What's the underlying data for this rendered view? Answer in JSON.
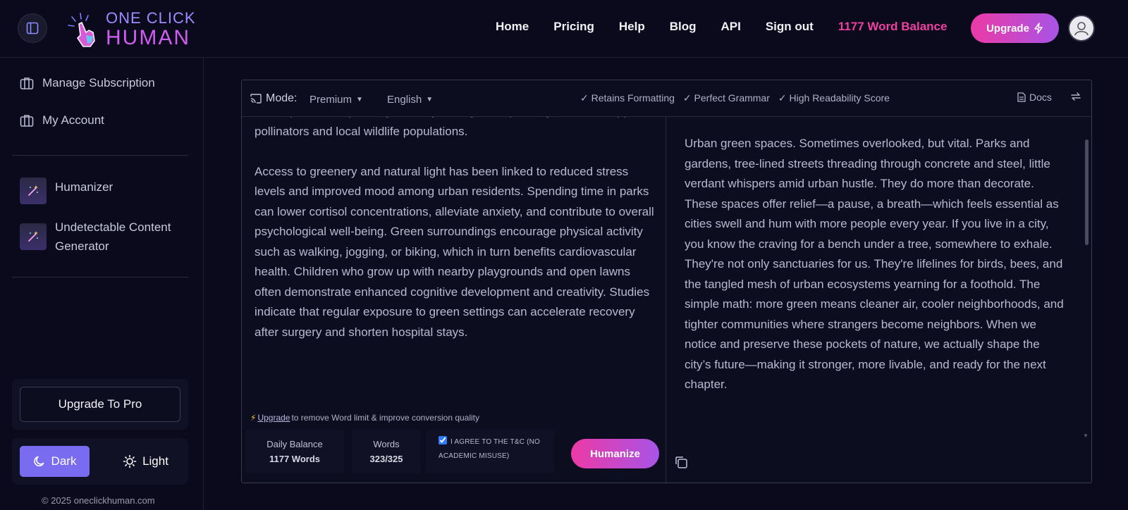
{
  "brand": {
    "logo_top": "ONE CLICK",
    "logo_bottom": "HUMAN"
  },
  "nav": {
    "home": "Home",
    "pricing": "Pricing",
    "help": "Help",
    "blog": "Blog",
    "api": "API",
    "sign_out": "Sign out",
    "word_balance": "1177 Word Balance",
    "upgrade": "Upgrade"
  },
  "sidebar": {
    "manage_subscription": "Manage Subscription",
    "my_account": "My Account",
    "humanizer": "Humanizer",
    "undetectable_line1": "Undetectable Content",
    "undetectable_line2": "Generator",
    "upgrade_pro": "Upgrade To Pro",
    "theme_dark": "Dark",
    "theme_light": "Light",
    "copyright": "© 2025 oneclickhuman.com"
  },
  "toolbar": {
    "mode_label": "Mode:",
    "mode_value": "Premium",
    "language_value": "English",
    "feature_1": "Retains Formatting",
    "feature_2": "Perfect Grammar",
    "feature_3": "High Readability Score",
    "docs": "Docs"
  },
  "input": {
    "para_partial": "native plants and planting diversity through tree planting efforts to support pollinators and local wildlife populations.",
    "para_main": "Access to greenery and natural light has been linked to reduced stress levels and improved mood among urban residents. Spending time in parks can lower cortisol concentrations, alleviate anxiety, and contribute to overall psychological well-being. Green surroundings encourage physical activity such as walking, jogging, or biking, which in turn benefits cardiovascular health. Children who grow up with nearby playgrounds and open lawns often demonstrate enhanced cognitive development and creativity. Studies indicate that regular exposure to green settings can accelerate recovery after surgery and shorten hospital stays."
  },
  "footer": {
    "upgrade_link": "Upgrade",
    "upgrade_note": " to remove Word limit & improve conversion quality",
    "daily_balance_label": "Daily Balance",
    "daily_balance_value": "1177 Words",
    "words_label": "Words",
    "words_value": "323/325",
    "agree_text": "I AGREE TO THE T&C (NO ACADEMIC MISUSE)",
    "agree_checked": true,
    "humanize": "Humanize"
  },
  "output": {
    "text": "Urban green spaces. Sometimes overlooked, but vital. Parks and gardens, tree-lined streets threading through concrete and steel, little verdant whispers amid urban hustle. They do more than decorate. These spaces offer relief—a pause, a breath—which feels essential as cities swell and hum with more people every year. If you live in a city, you know the craving for a bench under a tree, somewhere to exhale. They're not only sanctuaries for us. They're lifelines for birds, bees, and the tangled mesh of urban ecosystems yearning for a foothold. The simple math: more green means cleaner air, cooler neighborhoods, and tighter communities where strangers become neighbors. When we notice and preserve these pockets of nature, we actually shape the city’s future—making it stronger, more livable, and ready for the next chapter."
  },
  "icons": {
    "sidebar_toggle": "sidebar-panel-icon",
    "upgrade": "lightning-icon",
    "avatar": "user-icon",
    "subscription": "briefcase-icon",
    "account": "briefcase-icon",
    "humanizer": "magic-wand-icon",
    "generator": "magic-wand-icon",
    "dark": "moon-icon",
    "light": "sun-icon",
    "mode": "cast-icon",
    "docs": "document-icon",
    "swap": "swap-icon",
    "copy": "copy-icon"
  },
  "colors": {
    "accent_pink": "#ec3aa6",
    "accent_purple": "#a854e6",
    "balance_pink": "#f040a0",
    "dark_theme_active": "#7a6cf0",
    "background": "#0a0a1c"
  }
}
